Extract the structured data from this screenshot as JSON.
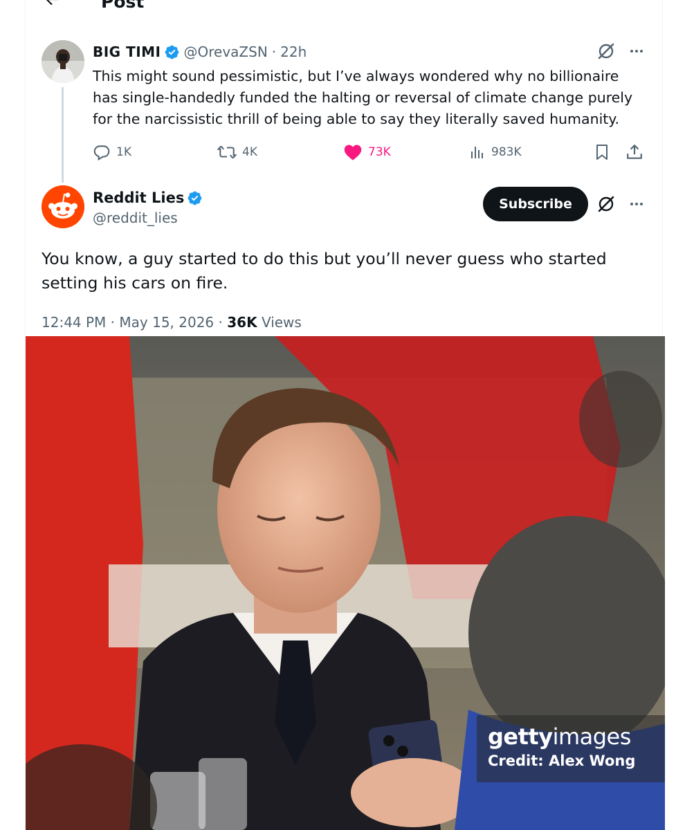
{
  "header": {
    "title": "Post"
  },
  "quoted_post": {
    "display_name": "BIG TIMI",
    "handle": "@OrevaZSN",
    "separator": "·",
    "time": "22h",
    "text": "This might sound pessimistic, but I’ve always wondered why no billionaire has single-handedly funded the halting or reversal of climate change purely for the narcissistic thrill of being able to say they literally saved humanity.",
    "stats": {
      "replies": "1K",
      "reposts": "4K",
      "likes": "73K",
      "views": "983K"
    }
  },
  "main_post": {
    "display_name": "Reddit Lies",
    "handle": "@reddit_lies",
    "subscribe_label": "Subscribe",
    "text": "You know, a guy started to do this but you’ll never guess who started setting his cars on fire.",
    "time": "12:44 PM",
    "separator": "·",
    "date": "May 15, 2026",
    "views_count": "36K",
    "views_label": "Views"
  },
  "photo": {
    "watermark_brand_bold": "getty",
    "watermark_brand_regular": "images",
    "watermark_credit": "Credit: Alex Wong"
  },
  "colors": {
    "verified": "#1d9bf0",
    "like": "#f91880",
    "reddit": "#ff4500",
    "subscribe_bg": "#0f1419"
  }
}
